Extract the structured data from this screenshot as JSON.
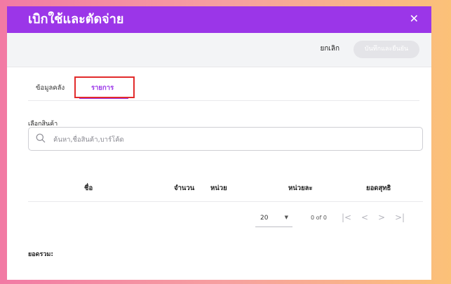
{
  "dialog": {
    "title": "เบิกใช้และตัดจ่าย",
    "close_icon": "close-icon"
  },
  "toolbar": {
    "cancel_label": "ยกเลิก",
    "save_label": "บันทึกและยืนยัน"
  },
  "tabs": [
    {
      "label": "ข้อมูลคลัง",
      "active": false
    },
    {
      "label": "รายการ",
      "active": true
    }
  ],
  "product_select": {
    "label": "เลือกสินค้า",
    "placeholder": "ค้นหา,ชื่อสินค้า,บาร์โค้ด",
    "icon": "search-icon"
  },
  "table": {
    "columns": [
      "ชื่อ",
      "จำนวน",
      "หน่วย",
      "หน่วยละ",
      "ยอดสุทธิ"
    ]
  },
  "pagination": {
    "rows_per_page": "20",
    "range": "0 of 0",
    "icons": [
      "first-page-icon",
      "prev-page-icon",
      "next-page-icon",
      "last-page-icon"
    ]
  },
  "summary": {
    "total_label": "ยอดรวม:"
  },
  "colors": {
    "accent": "#9b36e8",
    "highlight": "#e22b2b"
  }
}
